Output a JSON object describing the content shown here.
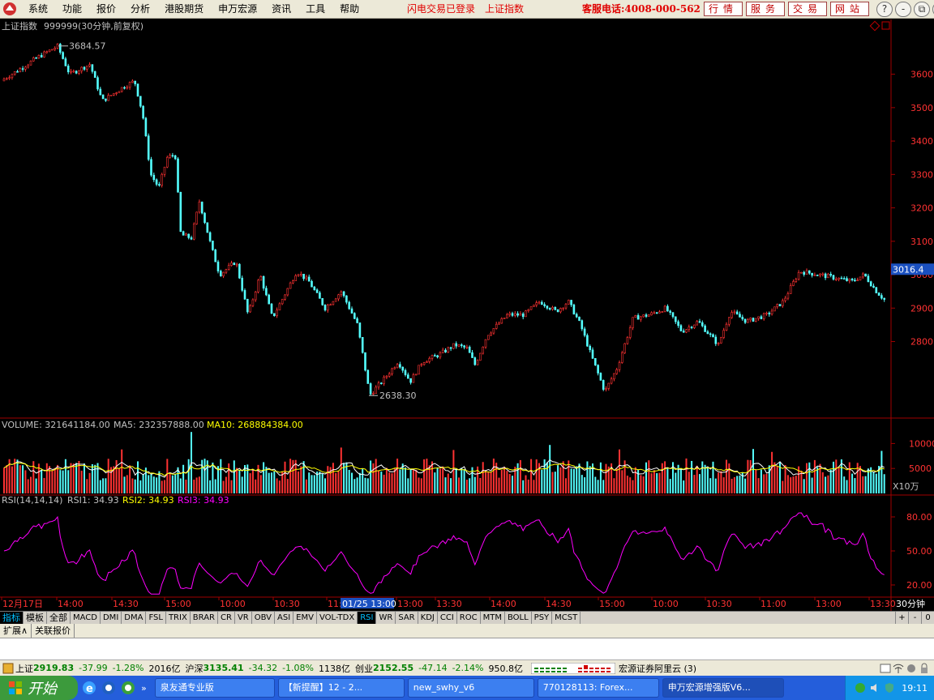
{
  "menubar": {
    "items": [
      "系统",
      "功能",
      "报价",
      "分析",
      "港股期货",
      "申万宏源",
      "资讯",
      "工具",
      "帮助"
    ],
    "status_flash": "闪电交易已登录",
    "status_index": "上证指数",
    "hotline": "客服电话:4008-000-562",
    "buttons": [
      "行情",
      "服务",
      "交易",
      "网站"
    ],
    "window_buttons": [
      "?",
      "-",
      "⧉",
      "✕"
    ]
  },
  "chart_header": {
    "security": "上证指数",
    "code": "999999(30分钟,前复权)"
  },
  "main_chart": {
    "high_label": "3684.57",
    "low_label": "2638.30",
    "last_price_label": "3016.4",
    "ytick_labels": [
      "3600",
      "3500",
      "3400",
      "3300",
      "3200",
      "3100",
      "3000",
      "2900",
      "2800"
    ],
    "ytick_values": [
      3600,
      3500,
      3400,
      3300,
      3200,
      3100,
      3000,
      2900,
      2800
    ],
    "ylim": [
      2600,
      3730
    ]
  },
  "volume_panel": {
    "label_volume": "VOLUME: 321641184.00",
    "label_ma5": "MA5: 232357888.00",
    "label_ma10": "MA10: 268884384.00",
    "ytick_labels": [
      "10000",
      "5000"
    ],
    "ytick_values": [
      10000,
      5000
    ],
    "unit_label": "X10万",
    "ylim": [
      0,
      12500
    ]
  },
  "rsi_panel": {
    "label_rsi": "RSI(14,14,14)",
    "label_rsi1": "RSI1: 34.93",
    "label_rsi2": "RSI2: 34.93",
    "label_rsi3": "RSI3: 34.93",
    "ytick_labels": [
      "80.00",
      "50.00",
      "20.00"
    ],
    "ytick_values": [
      80,
      50,
      20
    ],
    "ylim": [
      10,
      90
    ]
  },
  "time_axis": {
    "labels": [
      "12月17日",
      "14:00",
      "14:30",
      "15:00",
      "10:00",
      "10:30",
      "11:00",
      "13:00",
      "13:30",
      "14:00",
      "14:30",
      "15:00",
      "10:00",
      "10:30",
      "11:00",
      "13:00",
      "13:30"
    ],
    "cursor_label": "01/25 13:00",
    "period_label": "30分钟"
  },
  "indicator_tabs": [
    "指标",
    "模板",
    "全部",
    "MACD",
    "DMI",
    "DMA",
    "FSL",
    "TRIX",
    "BRAR",
    "CR",
    "VR",
    "OBV",
    "ASI",
    "EMV",
    "VOL-TDX",
    "RSI",
    "WR",
    "SAR",
    "KDJ",
    "CCI",
    "ROC",
    "MTM",
    "BOLL",
    "PSY",
    "MCST"
  ],
  "indicator_tab_active": "RSI",
  "tab_controls": [
    "+",
    "-",
    "0"
  ],
  "sub_tabs": [
    "扩展∧",
    "关联报价"
  ],
  "status_bar": {
    "sh_name": "上证",
    "sh_price": "2919.83",
    "sh_chg": "-37.99",
    "sh_pct": "-1.28%",
    "sh_amt": "2016亿",
    "hs_name": "沪深",
    "hs_price": "3135.41",
    "hs_chg": "-34.32",
    "hs_pct": "-1.08%",
    "hs_amt": "1138亿",
    "cy_name": "创业",
    "cy_price": "2152.55",
    "cy_chg": "-47.14",
    "cy_pct": "-2.14%",
    "cy_amt": "950.8亿",
    "broker": "宏源证券阿里云 (3)"
  },
  "taskbar": {
    "start_label": "开始",
    "tasks": [
      "泉友通专业版",
      "【新提醒】12 - 2...",
      "new_swhy_v6",
      "770128113: Forex...",
      "申万宏源增强版V6..."
    ],
    "clock": "19:11"
  },
  "colors": {
    "up": "#ff3232",
    "down": "#54ffff",
    "ma5": "#ffffff",
    "ma10": "#ffff00",
    "rsi": "#ff00ff",
    "axis_red": "#a00000"
  }
}
